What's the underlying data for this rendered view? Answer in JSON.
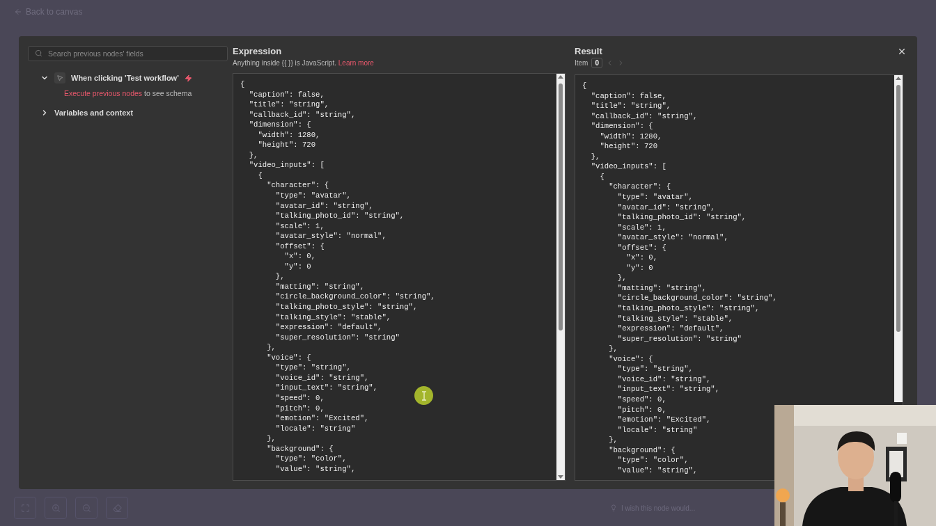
{
  "top_bar": {
    "back_link": "Back to canvas"
  },
  "sidebar": {
    "search": {
      "placeholder": "Search previous nodes' fields"
    },
    "items": [
      {
        "kind": "trigger",
        "label": "When clicking 'Test workflow'",
        "expanded": true,
        "hint_link": "Execute previous nodes",
        "hint_text": " to see schema"
      },
      {
        "kind": "group",
        "label": "Variables and context",
        "expanded": false
      }
    ]
  },
  "expression": {
    "title": "Expression",
    "note": "Anything inside {{  }} is JavaScript.",
    "learn_more": "Learn more",
    "lines": [
      "{",
      "  \"caption\": false,",
      "  \"title\": \"string\",",
      "  \"callback_id\": \"string\",",
      "  \"dimension\": {",
      "    \"width\": 1280,",
      "    \"height\": 720",
      "  },",
      "  \"video_inputs\": [",
      "    {",
      "      \"character\": {",
      "        \"type\": \"avatar\",",
      "        \"avatar_id\": \"string\",",
      "        \"talking_photo_id\": \"string\",",
      "        \"scale\": 1,",
      "        \"avatar_style\": \"normal\",",
      "        \"offset\": {",
      "          \"x\": 0,",
      "          \"y\": 0",
      "        },",
      "        \"matting\": \"string\",",
      "        \"circle_background_color\": \"string\",",
      "        \"talking_photo_style\": \"string\",",
      "        \"talking_style\": \"stable\",",
      "        \"expression\": \"default\",",
      "        \"super_resolution\": \"string\"",
      "      },",
      "      \"voice\": {",
      "        \"type\": \"string\",",
      "        \"voice_id\": \"string\",",
      "        \"input_text\": \"string\",",
      "        \"speed\": 0,",
      "        \"pitch\": 0,",
      "        \"emotion\": \"Excited\",",
      "        \"locale\": \"string\"",
      "      },",
      "      \"background\": {",
      "        \"type\": \"color\",",
      "        \"value\": \"string\","
    ]
  },
  "result": {
    "title": "Result",
    "item_label": "Item",
    "item_value": "0",
    "lines": [
      "{",
      "  \"caption\": false,",
      "  \"title\": \"string\",",
      "  \"callback_id\": \"string\",",
      "  \"dimension\": {",
      "    \"width\": 1280,",
      "    \"height\": 720",
      "  },",
      "  \"video_inputs\": [",
      "    {",
      "      \"character\": {",
      "        \"type\": \"avatar\",",
      "        \"avatar_id\": \"string\",",
      "        \"talking_photo_id\": \"string\",",
      "        \"scale\": 1,",
      "        \"avatar_style\": \"normal\",",
      "        \"offset\": {",
      "          \"x\": 0,",
      "          \"y\": 0",
      "        },",
      "        \"matting\": \"string\",",
      "        \"circle_background_color\": \"string\",",
      "        \"talking_photo_style\": \"string\",",
      "        \"talking_style\": \"stable\",",
      "        \"expression\": \"default\",",
      "        \"super_resolution\": \"string\"",
      "      },",
      "      \"voice\": {",
      "        \"type\": \"string\",",
      "        \"voice_id\": \"string\",",
      "        \"input_text\": \"string\",",
      "        \"speed\": 0,",
      "        \"pitch\": 0,",
      "        \"emotion\": \"Excited\",",
      "        \"locale\": \"string\"",
      "      },",
      "      \"background\": {",
      "        \"type\": \"color\",",
      "        \"value\": \"string\","
    ]
  },
  "bottom": {
    "hint": "I wish this node would..."
  }
}
